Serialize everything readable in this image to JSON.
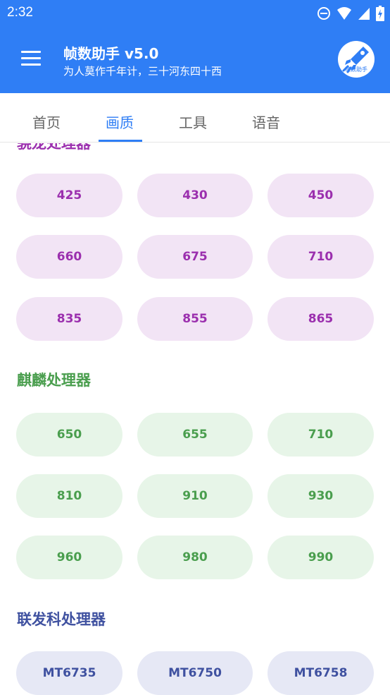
{
  "status": {
    "time": "2:32"
  },
  "app": {
    "title": "帧数助手 v5.0",
    "subtitle": "为人莫作千年计，三十河东四十西",
    "logo_text": "帧数助手"
  },
  "tabs": [
    {
      "label": "首页"
    },
    {
      "label": "画质"
    },
    {
      "label": "工具"
    },
    {
      "label": "语音"
    }
  ],
  "sections": [
    {
      "title": "骁龙处理器",
      "color": "#9b2fae",
      "rows": [
        [
          "425",
          "430",
          "450"
        ],
        [
          "660",
          "675",
          "710"
        ],
        [
          "835",
          "855",
          "865"
        ]
      ]
    },
    {
      "title": "麒麟处理器",
      "color": "#4a9e4e",
      "rows": [
        [
          "650",
          "655",
          "710"
        ],
        [
          "810",
          "910",
          "930"
        ],
        [
          "960",
          "980",
          "990"
        ]
      ]
    },
    {
      "title": "联发科处理器",
      "color": "#3f51a0",
      "rows": [
        [
          "MT6735",
          "MT6750",
          "MT6758"
        ]
      ]
    }
  ]
}
